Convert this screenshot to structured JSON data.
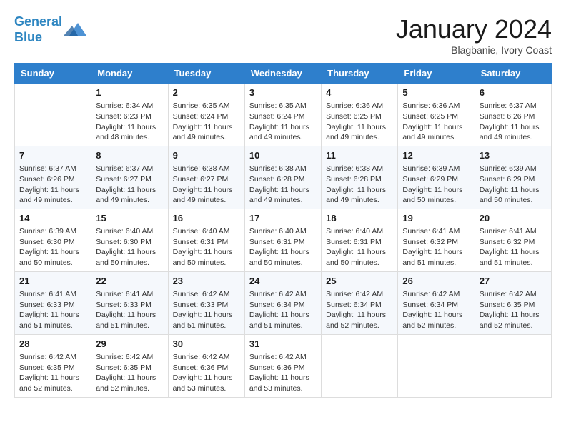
{
  "logo": {
    "line1": "General",
    "line2": "Blue"
  },
  "title": "January 2024",
  "location": "Blagbanie, Ivory Coast",
  "days_header": [
    "Sunday",
    "Monday",
    "Tuesday",
    "Wednesday",
    "Thursday",
    "Friday",
    "Saturday"
  ],
  "weeks": [
    [
      {
        "day": "",
        "text": ""
      },
      {
        "day": "1",
        "text": "Sunrise: 6:34 AM\nSunset: 6:23 PM\nDaylight: 11 hours\nand 48 minutes."
      },
      {
        "day": "2",
        "text": "Sunrise: 6:35 AM\nSunset: 6:24 PM\nDaylight: 11 hours\nand 49 minutes."
      },
      {
        "day": "3",
        "text": "Sunrise: 6:35 AM\nSunset: 6:24 PM\nDaylight: 11 hours\nand 49 minutes."
      },
      {
        "day": "4",
        "text": "Sunrise: 6:36 AM\nSunset: 6:25 PM\nDaylight: 11 hours\nand 49 minutes."
      },
      {
        "day": "5",
        "text": "Sunrise: 6:36 AM\nSunset: 6:25 PM\nDaylight: 11 hours\nand 49 minutes."
      },
      {
        "day": "6",
        "text": "Sunrise: 6:37 AM\nSunset: 6:26 PM\nDaylight: 11 hours\nand 49 minutes."
      }
    ],
    [
      {
        "day": "7",
        "text": "Sunrise: 6:37 AM\nSunset: 6:26 PM\nDaylight: 11 hours\nand 49 minutes."
      },
      {
        "day": "8",
        "text": "Sunrise: 6:37 AM\nSunset: 6:27 PM\nDaylight: 11 hours\nand 49 minutes."
      },
      {
        "day": "9",
        "text": "Sunrise: 6:38 AM\nSunset: 6:27 PM\nDaylight: 11 hours\nand 49 minutes."
      },
      {
        "day": "10",
        "text": "Sunrise: 6:38 AM\nSunset: 6:28 PM\nDaylight: 11 hours\nand 49 minutes."
      },
      {
        "day": "11",
        "text": "Sunrise: 6:38 AM\nSunset: 6:28 PM\nDaylight: 11 hours\nand 49 minutes."
      },
      {
        "day": "12",
        "text": "Sunrise: 6:39 AM\nSunset: 6:29 PM\nDaylight: 11 hours\nand 50 minutes."
      },
      {
        "day": "13",
        "text": "Sunrise: 6:39 AM\nSunset: 6:29 PM\nDaylight: 11 hours\nand 50 minutes."
      }
    ],
    [
      {
        "day": "14",
        "text": "Sunrise: 6:39 AM\nSunset: 6:30 PM\nDaylight: 11 hours\nand 50 minutes."
      },
      {
        "day": "15",
        "text": "Sunrise: 6:40 AM\nSunset: 6:30 PM\nDaylight: 11 hours\nand 50 minutes."
      },
      {
        "day": "16",
        "text": "Sunrise: 6:40 AM\nSunset: 6:31 PM\nDaylight: 11 hours\nand 50 minutes."
      },
      {
        "day": "17",
        "text": "Sunrise: 6:40 AM\nSunset: 6:31 PM\nDaylight: 11 hours\nand 50 minutes."
      },
      {
        "day": "18",
        "text": "Sunrise: 6:40 AM\nSunset: 6:31 PM\nDaylight: 11 hours\nand 50 minutes."
      },
      {
        "day": "19",
        "text": "Sunrise: 6:41 AM\nSunset: 6:32 PM\nDaylight: 11 hours\nand 51 minutes."
      },
      {
        "day": "20",
        "text": "Sunrise: 6:41 AM\nSunset: 6:32 PM\nDaylight: 11 hours\nand 51 minutes."
      }
    ],
    [
      {
        "day": "21",
        "text": "Sunrise: 6:41 AM\nSunset: 6:33 PM\nDaylight: 11 hours\nand 51 minutes."
      },
      {
        "day": "22",
        "text": "Sunrise: 6:41 AM\nSunset: 6:33 PM\nDaylight: 11 hours\nand 51 minutes."
      },
      {
        "day": "23",
        "text": "Sunrise: 6:42 AM\nSunset: 6:33 PM\nDaylight: 11 hours\nand 51 minutes."
      },
      {
        "day": "24",
        "text": "Sunrise: 6:42 AM\nSunset: 6:34 PM\nDaylight: 11 hours\nand 51 minutes."
      },
      {
        "day": "25",
        "text": "Sunrise: 6:42 AM\nSunset: 6:34 PM\nDaylight: 11 hours\nand 52 minutes."
      },
      {
        "day": "26",
        "text": "Sunrise: 6:42 AM\nSunset: 6:34 PM\nDaylight: 11 hours\nand 52 minutes."
      },
      {
        "day": "27",
        "text": "Sunrise: 6:42 AM\nSunset: 6:35 PM\nDaylight: 11 hours\nand 52 minutes."
      }
    ],
    [
      {
        "day": "28",
        "text": "Sunrise: 6:42 AM\nSunset: 6:35 PM\nDaylight: 11 hours\nand 52 minutes."
      },
      {
        "day": "29",
        "text": "Sunrise: 6:42 AM\nSunset: 6:35 PM\nDaylight: 11 hours\nand 52 minutes."
      },
      {
        "day": "30",
        "text": "Sunrise: 6:42 AM\nSunset: 6:36 PM\nDaylight: 11 hours\nand 53 minutes."
      },
      {
        "day": "31",
        "text": "Sunrise: 6:42 AM\nSunset: 6:36 PM\nDaylight: 11 hours\nand 53 minutes."
      },
      {
        "day": "",
        "text": ""
      },
      {
        "day": "",
        "text": ""
      },
      {
        "day": "",
        "text": ""
      }
    ]
  ]
}
